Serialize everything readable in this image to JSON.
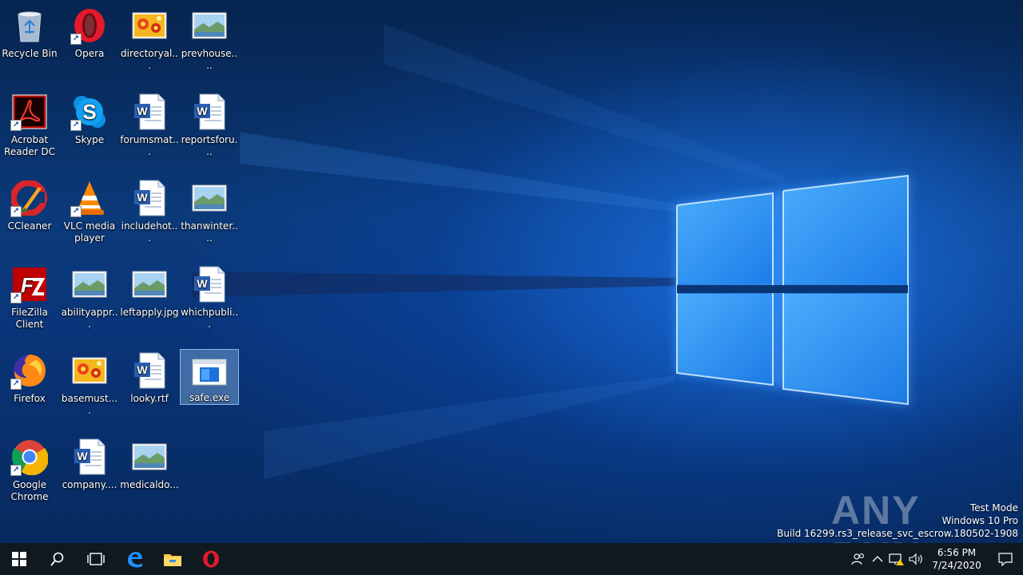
{
  "desktop": {
    "icons": [
      {
        "label": "Recycle Bin",
        "type": "recycle"
      },
      {
        "label": "Opera",
        "type": "opera"
      },
      {
        "label": "directoryal...",
        "type": "flowerimg"
      },
      {
        "label": "prevhouse....",
        "type": "landscape"
      },
      {
        "label": "Acrobat Reader DC",
        "type": "acrobat"
      },
      {
        "label": "Skype",
        "type": "skype"
      },
      {
        "label": "forumsmat...",
        "type": "word"
      },
      {
        "label": "reportsforu...",
        "type": "word"
      },
      {
        "label": "CCleaner",
        "type": "ccleaner"
      },
      {
        "label": "VLC media player",
        "type": "vlc"
      },
      {
        "label": "includehot...",
        "type": "word"
      },
      {
        "label": "thanwinter....",
        "type": "landscape"
      },
      {
        "label": "FileZilla Client",
        "type": "filezilla"
      },
      {
        "label": "abilityappr...",
        "type": "landscape"
      },
      {
        "label": "leftapply.jpg",
        "type": "landscape"
      },
      {
        "label": "whichpubli...",
        "type": "word"
      },
      {
        "label": "Firefox",
        "type": "firefox"
      },
      {
        "label": "basemust....",
        "type": "flowerimg"
      },
      {
        "label": "looky.rtf",
        "type": "word"
      },
      {
        "label": "safe.exe",
        "type": "exe"
      },
      {
        "label": "Google Chrome",
        "type": "chrome"
      },
      {
        "label": "company....",
        "type": "word"
      },
      {
        "label": "medicaldo...",
        "type": "landscape"
      }
    ]
  },
  "watermark": {
    "brand": "ANY RUN",
    "line1": "Test Mode",
    "line2": "Windows 10 Pro",
    "line3": "Build 16299.rs3_release_svc_escrow.180502-1908"
  },
  "taskbar": {
    "pinned": [
      "start-icon",
      "search-icon",
      "task-view-icon",
      "edge-icon",
      "file-explorer-icon",
      "opera-icon"
    ],
    "tray": [
      "people-icon",
      "chevron-up-icon",
      "network-icon",
      "volume-icon"
    ],
    "time": "6:56 PM",
    "date": "7/24/2020"
  },
  "colors": {
    "taskbar": "#101820",
    "selection": "#8cb9e6",
    "wallpaper_glow": "#3a9bff"
  }
}
